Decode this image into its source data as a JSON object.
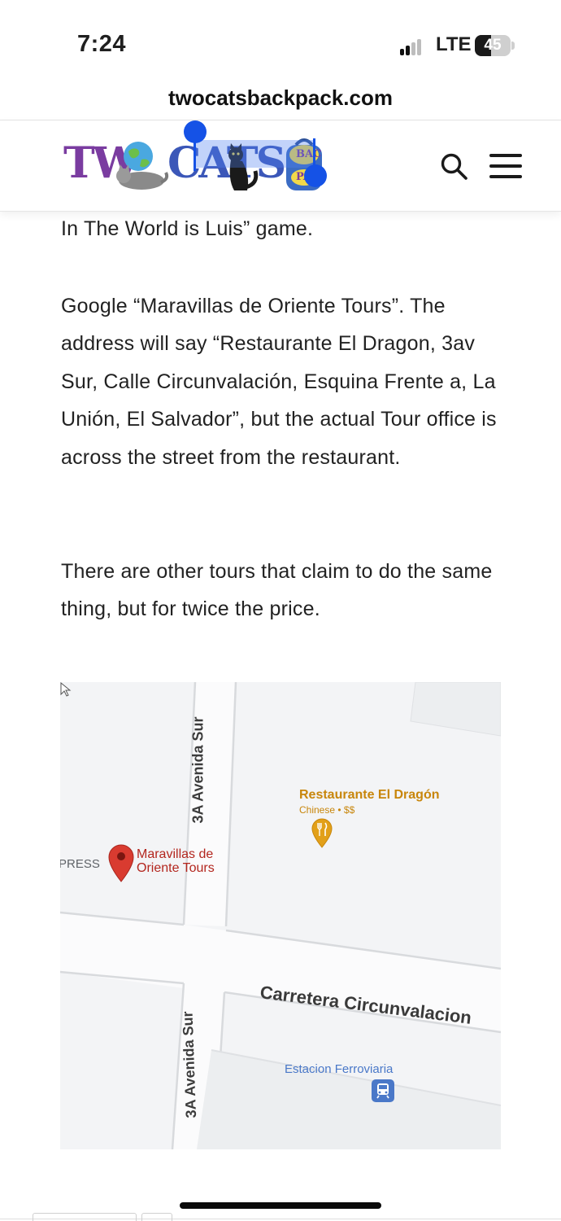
{
  "status_bar": {
    "time": "7:24",
    "network": "LTE",
    "battery_level": "45"
  },
  "browser": {
    "url": "twocatsbackpack.com"
  },
  "site_header": {
    "logo_word_1": "TW",
    "logo_word_2": "CATS",
    "logo_badge_line_1": "BAC",
    "logo_badge_line_2": "PA"
  },
  "article": {
    "paragraph_1": "In The World is Luis” game.",
    "paragraph_2": "Google “Maravillas de Oriente Tours”.  The address will say “Restaurante El Dragon, 3av Sur, Calle Circunvalación, Esquina Frente a, La Unión, El Salvador”, but the actual Tour office is across the street from the restaurant.",
    "paragraph_3": "There are other tours that claim to do the same thing, but for twice the price."
  },
  "map": {
    "street_north": "3A Avenida Sur",
    "street_south": "3A Avenida Sur",
    "main_road": "Carretera Circunvalacion",
    "restaurant_name": "Restaurante El Dragón",
    "restaurant_detail": "Chinese • $$",
    "tour_name_line_1": "Maravillas de",
    "tour_name_line_2": "Oriente Tours",
    "edge_label": "PRESS",
    "station_name": "Estacion Ferroviaria"
  },
  "colors": {
    "selection_blue": "#1552e6",
    "restaurant_orange": "#c8860b",
    "tour_pin_red": "#d93b30",
    "tour_label_red": "#b3261e",
    "station_blue": "#4a78c8"
  },
  "icons": {
    "search": "search-icon",
    "menu": "hamburger-menu-icon",
    "restaurant_pin": "fork-knife-pin-icon",
    "tour_pin": "red-location-pin-icon",
    "station": "train-icon"
  }
}
